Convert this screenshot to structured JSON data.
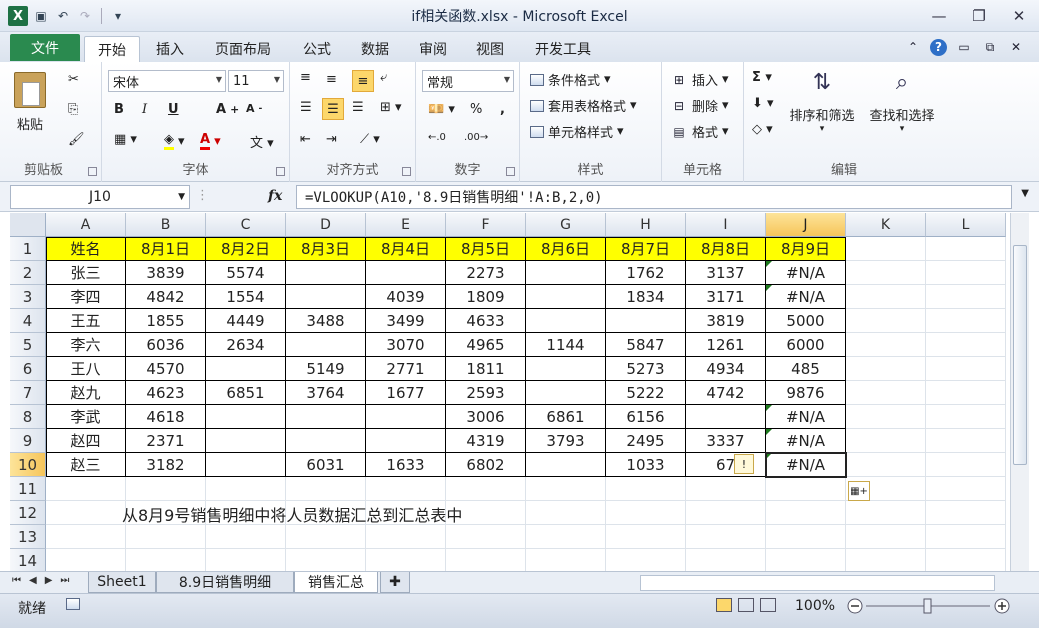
{
  "window": {
    "title": "if相关函数.xlsx - Microsoft Excel",
    "minimize": "—",
    "restore": "❐",
    "close": "✕"
  },
  "ribbon_tabs": [
    "文件",
    "开始",
    "插入",
    "页面布局",
    "公式",
    "数据",
    "审阅",
    "视图",
    "开发工具"
  ],
  "ribbon": {
    "clipboard": {
      "label": "剪贴板",
      "paste": "粘贴"
    },
    "font": {
      "label": "字体",
      "font_name": "宋体",
      "font_size": "11",
      "bold": "B",
      "italic": "I",
      "underline": "U"
    },
    "alignment": {
      "label": "对齐方式"
    },
    "number": {
      "label": "数字",
      "format": "常规"
    },
    "styles": {
      "label": "样式",
      "conditional": "条件格式",
      "table": "套用表格格式",
      "cell": "单元格样式"
    },
    "cells": {
      "label": "单元格",
      "insert": "插入",
      "delete": "删除",
      "format": "格式"
    },
    "editing": {
      "label": "编辑",
      "sort": "排序和筛选",
      "find": "查找和选择"
    }
  },
  "formula_bar": {
    "name_box": "J10",
    "fx": "fx",
    "formula": "=VLOOKUP(A10,'8.9日销售明细'!A:B,2,0)"
  },
  "columns": [
    "A",
    "B",
    "C",
    "D",
    "E",
    "F",
    "G",
    "H",
    "I",
    "J",
    "K",
    "L"
  ],
  "row_numbers": [
    "1",
    "2",
    "3",
    "4",
    "5",
    "6",
    "7",
    "8",
    "9",
    "10",
    "11",
    "12",
    "13",
    "14"
  ],
  "table": {
    "header": [
      "姓名",
      "8月1日",
      "8月2日",
      "8月3日",
      "8月4日",
      "8月5日",
      "8月6日",
      "8月7日",
      "8月8日",
      "8月9日"
    ],
    "rows": [
      [
        "张三",
        "3839",
        "5574",
        "",
        "",
        "2273",
        "",
        "1762",
        "3137",
        "#N/A"
      ],
      [
        "李四",
        "4842",
        "1554",
        "",
        "4039",
        "1809",
        "",
        "1834",
        "3171",
        "#N/A"
      ],
      [
        "王五",
        "1855",
        "4449",
        "3488",
        "3499",
        "4633",
        "",
        "",
        "3819",
        "5000"
      ],
      [
        "李六",
        "6036",
        "2634",
        "",
        "3070",
        "4965",
        "1144",
        "5847",
        "1261",
        "6000"
      ],
      [
        "王八",
        "4570",
        "",
        "5149",
        "2771",
        "1811",
        "",
        "5273",
        "4934",
        "485"
      ],
      [
        "赵九",
        "4623",
        "6851",
        "3764",
        "1677",
        "2593",
        "",
        "5222",
        "4742",
        "9876"
      ],
      [
        "李武",
        "4618",
        "",
        "",
        "",
        "3006",
        "6861",
        "6156",
        "",
        "#N/A"
      ],
      [
        "赵四",
        "2371",
        "",
        "",
        "",
        "4319",
        "3793",
        "2495",
        "3337",
        "#N/A"
      ],
      [
        "赵三",
        "3182",
        "",
        "6031",
        "1633",
        "6802",
        "",
        "1033",
        "67",
        "#N/A"
      ]
    ]
  },
  "note": "从8月9号销售明细中将人员数据汇总到汇总表中",
  "sheet_tabs": [
    "Sheet1",
    "8.9日销售明细",
    "销售汇总"
  ],
  "status": {
    "ready": "就绪",
    "zoom": "100%"
  }
}
